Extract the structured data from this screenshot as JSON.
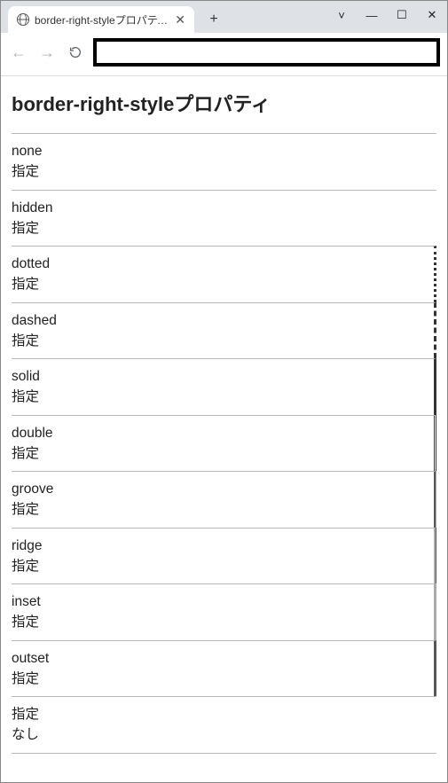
{
  "window": {
    "tab_title": "border-right-styleプロパティサン",
    "minimize_glyph": "—",
    "maximize_glyph": "☐",
    "close_glyph": "✕",
    "chevron_glyph": "˅",
    "new_tab_glyph": "+",
    "tab_close_glyph": "✕"
  },
  "toolbar": {
    "back_glyph": "←",
    "forward_glyph": "→",
    "url_value": ""
  },
  "page": {
    "heading": "border-right-styleプロパティ",
    "examples": [
      {
        "line1": "none",
        "line2": "指定",
        "cls": "ex-none"
      },
      {
        "line1": "hidden",
        "line2": "指定",
        "cls": "ex-hidden"
      },
      {
        "line1": "dotted",
        "line2": "指定",
        "cls": "ex-dotted"
      },
      {
        "line1": "dashed",
        "line2": "指定",
        "cls": "ex-dashed"
      },
      {
        "line1": "solid",
        "line2": "指定",
        "cls": "ex-solid"
      },
      {
        "line1": "double",
        "line2": "指定",
        "cls": "ex-double"
      },
      {
        "line1": "groove",
        "line2": "指定",
        "cls": "ex-groove"
      },
      {
        "line1": "ridge",
        "line2": "指定",
        "cls": "ex-ridge"
      },
      {
        "line1": "inset",
        "line2": "指定",
        "cls": "ex-inset"
      },
      {
        "line1": "outset",
        "line2": "指定",
        "cls": "ex-outset"
      },
      {
        "line1": "指定",
        "line2": "なし",
        "cls": "ex-plain"
      }
    ]
  }
}
